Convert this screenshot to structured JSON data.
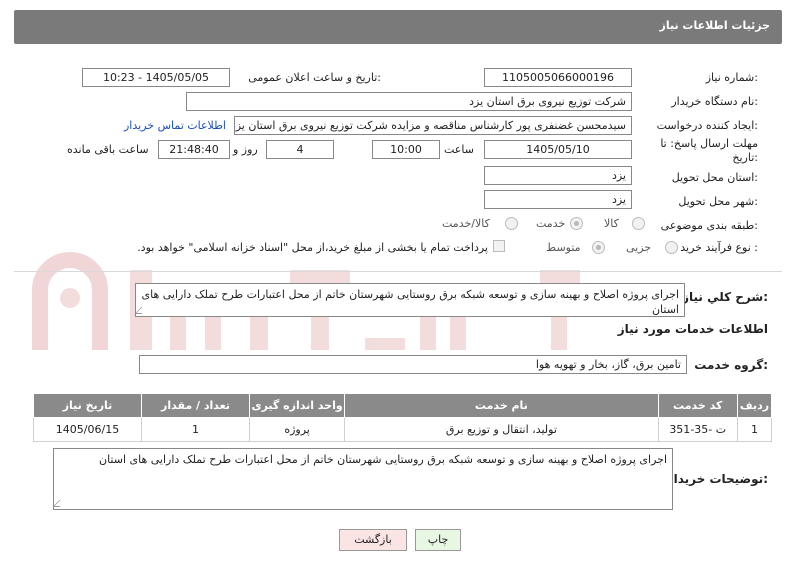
{
  "header": {
    "title": "جزئیات اطلاعات نیاز"
  },
  "form": {
    "need_number_label": "شماره نیاز:",
    "need_number": "1105005066000196",
    "announce_label": "تاریخ و ساعت اعلان عمومی:",
    "announce_value": "1405/05/05 - 10:23",
    "buyer_org_label": "نام دستگاه خریدار:",
    "buyer_org": "شرکت توزیع نیروی برق استان یزد",
    "creator_label": "ایجاد کننده درخواست:",
    "creator": "سیدمحسن غضنفری پور کارشناس مناقصه و مزایده شرکت توزیع نیروی برق استان یزد",
    "contact_link": "اطلاعات تماس خریدار",
    "deadline_label_1": "مهلت ارسال پاسخ: تا",
    "deadline_label_2": "تاریخ:",
    "deadline_date": "1405/05/10",
    "time_label": "ساعت",
    "deadline_time": "10:00",
    "days_value": "4",
    "days_label": "روز و",
    "remaining_time": "21:48:40",
    "remaining_label": "ساعت باقی مانده",
    "province_label": "استان محل تحویل:",
    "province": "یزد",
    "city_label": "شهر محل تحویل:",
    "city": "یزد",
    "category_label": "طبقه بندی موضوعی:",
    "category_options": [
      "کالا",
      "خدمت",
      "کالا/خدمت"
    ],
    "process_label": "نوع فرآیند خرید :",
    "process_options": [
      "جزیی",
      "متوسط"
    ],
    "payment_note": "پرداخت تمام یا بخشی از مبلغ خرید،از محل \"اسناد خزانه اسلامی\" خواهد بود."
  },
  "summary": {
    "label": "شرح كلي نياز:",
    "text": "اجرای پروژه اصلاح و بهینه سازی و توسعه شبکه برق روستایی شهرستان خاتم از محل اعتبارات طرح تملک دارایی های استان"
  },
  "services_section": {
    "title": "اطلاعات خدمات مورد نیاز",
    "group_label": "گروه خدمت:",
    "group_value": "تامین برق، گاز، بخار و تهویه هوا"
  },
  "table": {
    "headers": [
      "ردیف",
      "کد خدمت",
      "نام خدمت",
      "واحد اندازه گیری",
      "تعداد / مقدار",
      "تاریخ نیاز"
    ],
    "rows": [
      [
        "1",
        "ت -35-351",
        "تولید، انتقال و توزیع برق",
        "پروژه",
        "1",
        "1405/06/15"
      ]
    ]
  },
  "buyer_notes": {
    "label": "توضیحات خریدار:",
    "text": "اجرای پروژه اصلاح و بهینه سازی و توسعه شبکه برق روستایی شهرستان خاتم از محل اعتبارات طرح تملک دارایی های استان"
  },
  "buttons": {
    "print": "چاپ",
    "back": "بازگشت"
  },
  "colors": {
    "header_bg": "#7a7a7a",
    "table_header_bg": "#8a8a8a",
    "link": "#1a4fb8",
    "print_bg": "#e8f7e4",
    "back_bg": "#fbe4e4",
    "watermark": "#f0d2d2"
  },
  "icons": {
    "watermark": "watermark-logo-icon",
    "resize": "resize-grip-icon"
  }
}
